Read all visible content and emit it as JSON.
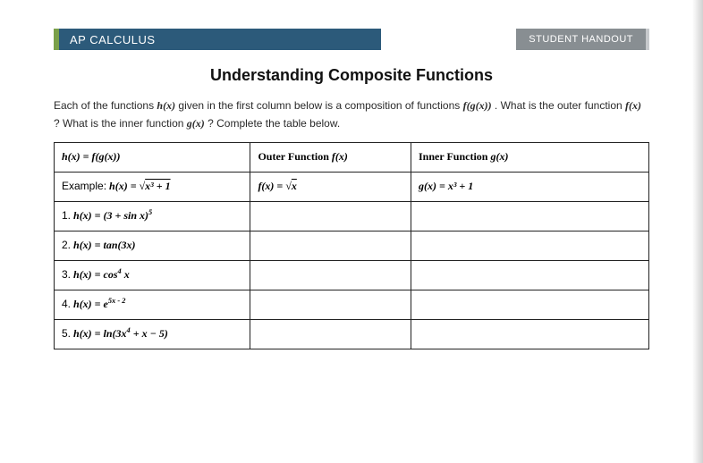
{
  "header": {
    "left": "AP CALCULUS",
    "right": "STUDENT HANDOUT"
  },
  "title": "Understanding Composite Functions",
  "intro": {
    "p1a": "Each of the functions ",
    "hx": "h(x)",
    "p1b": " given in the first column below is a composition of functions ",
    "fgx": "f(g(x))",
    "p1c": ".  What is the outer function ",
    "fx": "f(x)",
    "p1d": " ? What is the inner function ",
    "gx": "g(x)",
    "p1e": " ? Complete the table below."
  },
  "table": {
    "head": {
      "c1a": "h(x) = f(g(x))",
      "c2a": "Outer Function ",
      "c2b": "f(x)",
      "c3a": "Inner Function ",
      "c3b": "g(x)"
    },
    "rows": [
      {
        "num": "Example:",
        "lhs": "h(x) = ",
        "expr_html": "&radic;<span style='text-decoration:overline'>x&sup3; + 1</span>",
        "outer_lhs": "f(x) = ",
        "outer_html": "&radic;<span style='text-decoration:overline'>x</span>",
        "inner_lhs": "g(x) = ",
        "inner_html": "x&sup3; + 1"
      },
      {
        "num": "1.",
        "lhs": "h(x) = ",
        "expr_html": "(3 + sin x)<sup>5</sup>",
        "outer_lhs": "",
        "outer_html": "",
        "inner_lhs": "",
        "inner_html": ""
      },
      {
        "num": "2.",
        "lhs": "h(x) = ",
        "expr_html": "tan(3x)",
        "outer_lhs": "",
        "outer_html": "",
        "inner_lhs": "",
        "inner_html": ""
      },
      {
        "num": "3.",
        "lhs": "h(x) = ",
        "expr_html": "cos<sup>4</sup> x",
        "outer_lhs": "",
        "outer_html": "",
        "inner_lhs": "",
        "inner_html": ""
      },
      {
        "num": "4.",
        "lhs": "h(x) = ",
        "expr_html": "e<sup>5x - 2</sup>",
        "outer_lhs": "",
        "outer_html": "",
        "inner_lhs": "",
        "inner_html": ""
      },
      {
        "num": "5.",
        "lhs": "h(x) = ",
        "expr_html": "ln(3x<sup>4</sup> + x &minus; 5)",
        "outer_lhs": "",
        "outer_html": "",
        "inner_lhs": "",
        "inner_html": ""
      }
    ]
  }
}
